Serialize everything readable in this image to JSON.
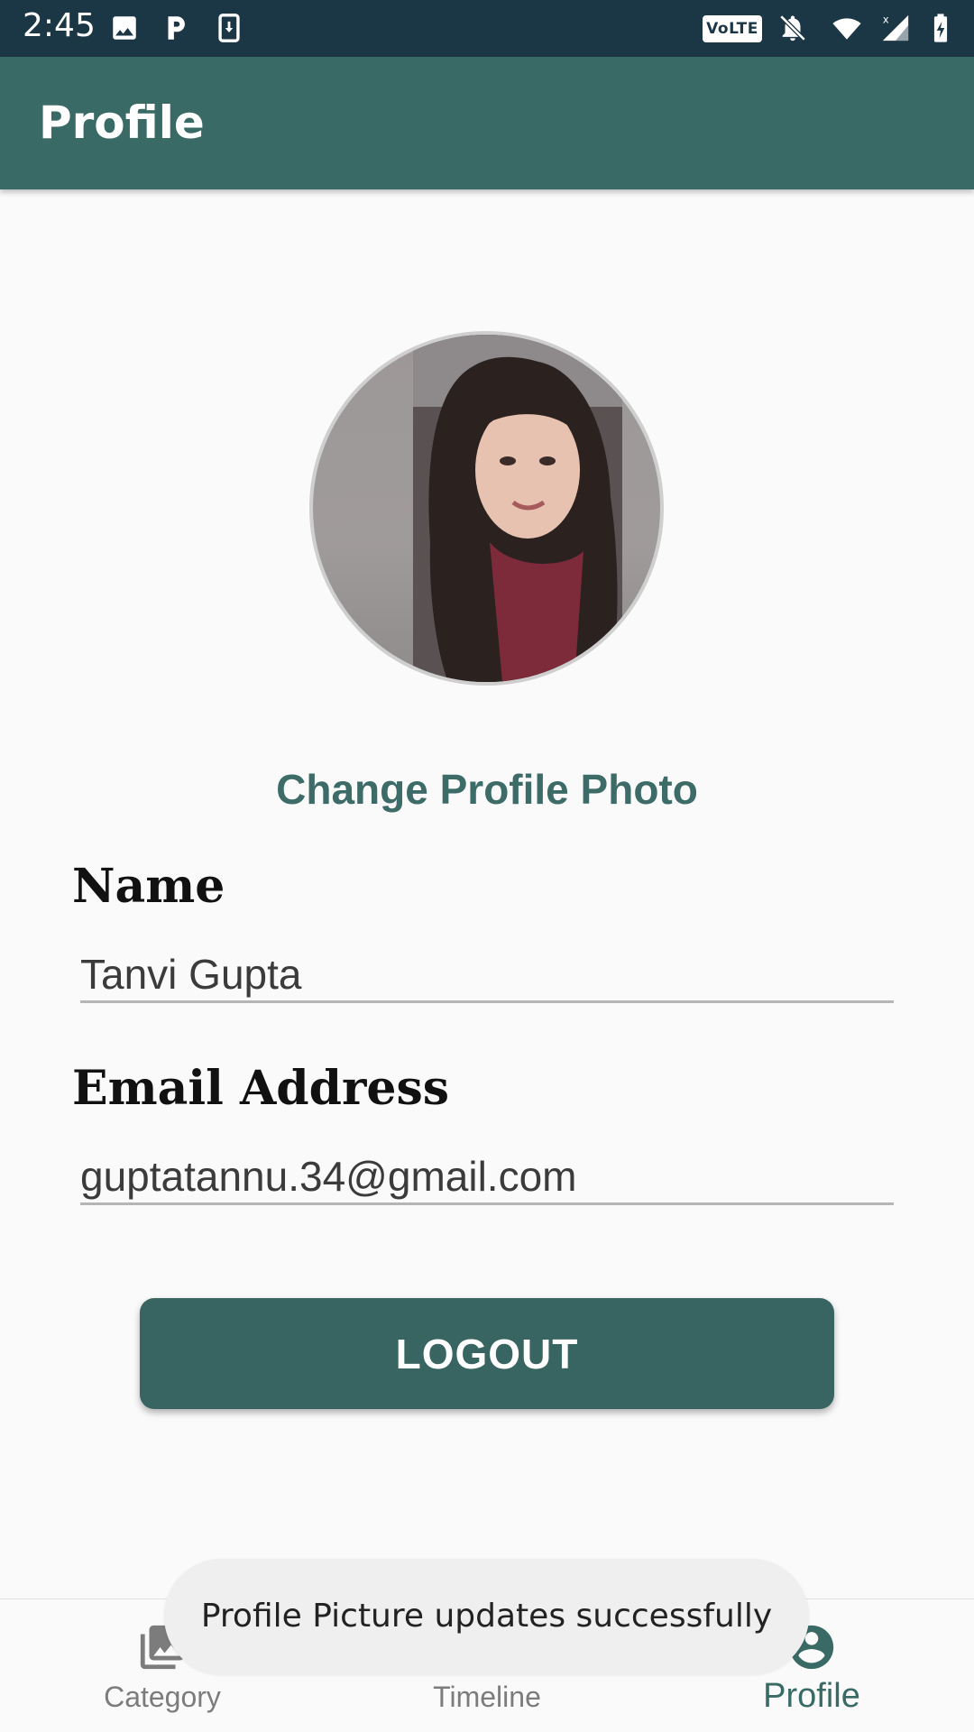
{
  "status_bar": {
    "time": "2:45",
    "volte": "VoLTE",
    "left_icons": [
      "image-icon",
      "parking-icon",
      "download-icon"
    ],
    "right_icons": [
      "volte-icon",
      "notifications-off-icon",
      "wifi-icon",
      "signal-icon",
      "battery-charging-icon"
    ]
  },
  "app_bar": {
    "title": "Profile"
  },
  "profile": {
    "change_photo_label": "Change Profile Photo",
    "name_label": "Name",
    "name_value": "Tanvi Gupta",
    "email_label": "Email Address",
    "email_value": "guptatannu.34@gmail.com",
    "logout_label": "LOGOUT"
  },
  "bottom_nav": {
    "items": [
      {
        "label": "Category",
        "icon": "photo-library-icon",
        "active": false
      },
      {
        "label": "Timeline",
        "icon": "timeline-icon",
        "active": false
      },
      {
        "label": "Profile",
        "icon": "account-circle-icon",
        "active": true
      }
    ]
  },
  "toast": {
    "message": "Profile Picture updates successfully"
  },
  "colors": {
    "status_bar": "#1b3645",
    "primary": "#3a6a66",
    "button": "#386561",
    "background": "#fafafa"
  }
}
